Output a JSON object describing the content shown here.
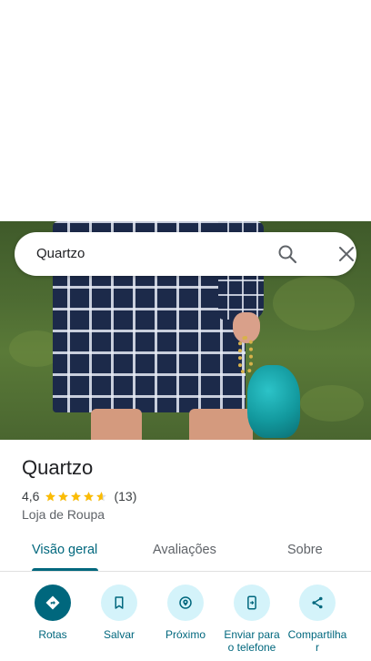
{
  "search": {
    "value": "Quartzo"
  },
  "place": {
    "name": "Quartzo",
    "rating": "4,6",
    "stars": 4.6,
    "review_count": "(13)",
    "category": "Loja de Roupa"
  },
  "tabs": [
    {
      "label": "Visão geral",
      "active": true
    },
    {
      "label": "Avaliações",
      "active": false
    },
    {
      "label": "Sobre",
      "active": false
    }
  ],
  "actions": [
    {
      "label": "Rotas",
      "icon": "directions-icon"
    },
    {
      "label": "Salvar",
      "icon": "bookmark-icon"
    },
    {
      "label": "Próximo",
      "icon": "nearby-icon"
    },
    {
      "label": "Enviar para o telefone",
      "icon": "send-to-phone-icon"
    },
    {
      "label": "Compartilhar",
      "icon": "share-icon"
    }
  ],
  "colors": {
    "accent": "#00677d",
    "accent_light": "#d4f3fa",
    "star": "#fbbc04"
  }
}
